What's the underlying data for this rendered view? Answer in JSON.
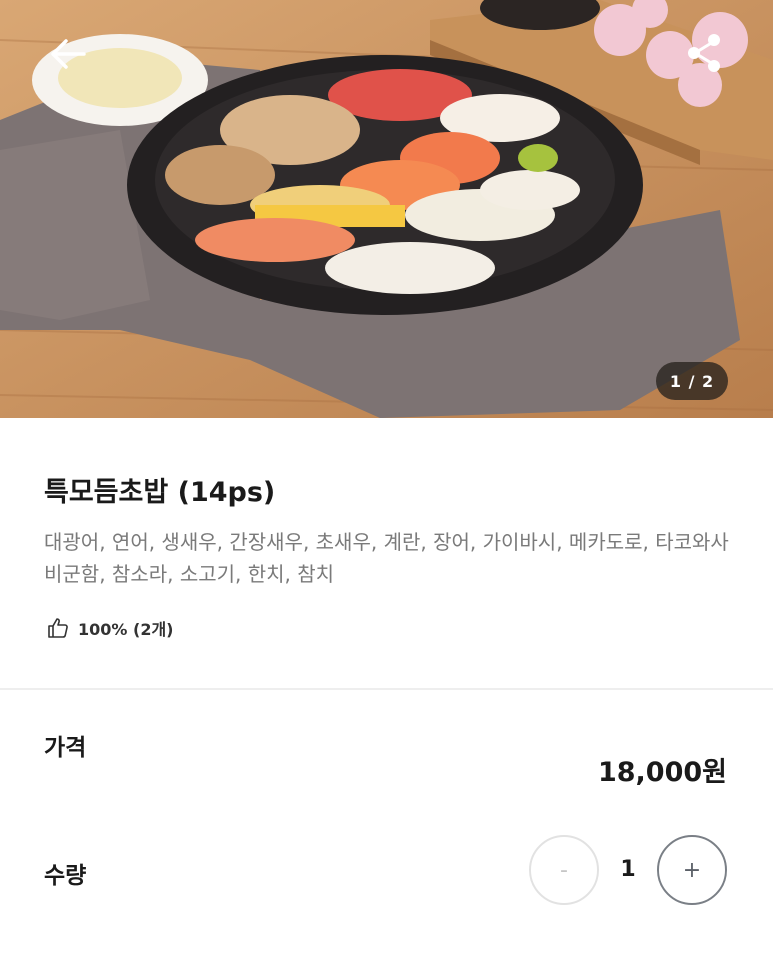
{
  "hero": {
    "image": "sushi-platter-photo",
    "pager_text": "1 / 2",
    "back_icon": "arrow-left-icon",
    "share_icon": "share-icon"
  },
  "product": {
    "title": "특모듬초밥 (14ps)",
    "description": "대광어, 연어, 생새우, 간장새우, 초새우, 계란, 장어, 가이바시, 메카도로, 타코와사비군함, 참소라, 소고기, 한치, 참치",
    "likes_text": "100% (2개)",
    "likes_icon": "thumbs-up-icon"
  },
  "price": {
    "label": "가격",
    "value": "18,000원"
  },
  "quantity": {
    "label": "수량",
    "value": "1",
    "minus_label": "-",
    "plus_label": "+"
  },
  "colors": {
    "text_primary": "#1a1a1a",
    "text_secondary": "#7a7a7a",
    "divider": "#eeeeee",
    "pager_bg": "#28221e"
  }
}
